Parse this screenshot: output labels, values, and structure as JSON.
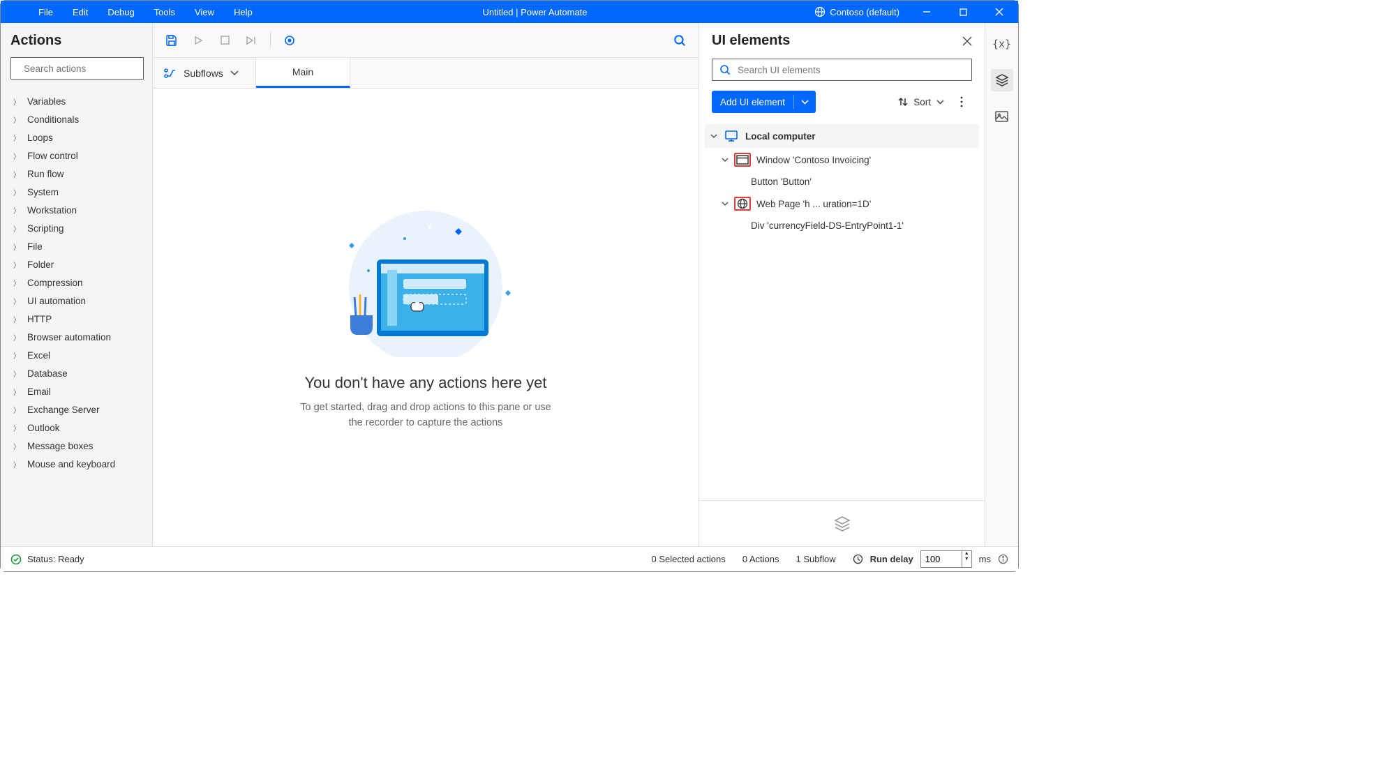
{
  "titlebar": {
    "menu": [
      "File",
      "Edit",
      "Debug",
      "Tools",
      "View",
      "Help"
    ],
    "title": "Untitled | Power Automate",
    "environment": "Contoso (default)"
  },
  "actions_panel": {
    "title": "Actions",
    "search_placeholder": "Search actions",
    "categories": [
      "Variables",
      "Conditionals",
      "Loops",
      "Flow control",
      "Run flow",
      "System",
      "Workstation",
      "Scripting",
      "File",
      "Folder",
      "Compression",
      "UI automation",
      "HTTP",
      "Browser automation",
      "Excel",
      "Database",
      "Email",
      "Exchange Server",
      "Outlook",
      "Message boxes",
      "Mouse and keyboard"
    ]
  },
  "tabs": {
    "subflows_label": "Subflows",
    "main_tab": "Main"
  },
  "canvas": {
    "heading": "You don't have any actions here yet",
    "sub1": "To get started, drag and drop actions to this pane or use the recorder to capture the actions"
  },
  "ui_elements": {
    "title": "UI elements",
    "search_placeholder": "Search UI elements",
    "add_button": "Add UI element",
    "sort_label": "Sort",
    "tree": {
      "root": "Local computer",
      "n1": "Window 'Contoso Invoicing'",
      "n1c": "Button 'Button'",
      "n2": "Web Page 'h ... uration=1D'",
      "n2c": "Div 'currencyField-DS-EntryPoint1-1'"
    }
  },
  "statusbar": {
    "status": "Status: Ready",
    "selected": "0 Selected actions",
    "actions_count": "0 Actions",
    "subflows": "1 Subflow",
    "run_delay_label": "Run delay",
    "run_delay_value": "100",
    "unit": "ms"
  }
}
